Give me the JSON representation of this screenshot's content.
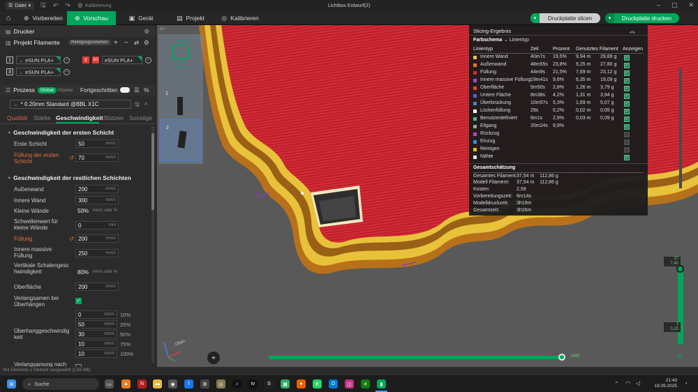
{
  "titlebar": {
    "menu_label": "Datei",
    "calibration_label": "Kalibrierung",
    "window_title": "Lichtbox Entwurf(2)"
  },
  "tabs": {
    "prepare": "Vorbereiten",
    "preview": "Vorschau",
    "device": "Gerät",
    "project": "Projekt",
    "calibrate": "Kalibrieren"
  },
  "actions": {
    "slice": "Druckplatte slicen",
    "print": "Druckplatte drucken"
  },
  "printer": {
    "header": "Drucker"
  },
  "filaments": {
    "header": "Projekt Filamente",
    "cleanup_button": "Reinigungsvolumen",
    "items": [
      {
        "num": "1",
        "name": "eSUN PLA+",
        "color": "#232323"
      },
      {
        "num": "2",
        "badge": "A1",
        "name": "eSUN PLA+",
        "color": "#e53935"
      },
      {
        "num": "3",
        "name": "eSUN PLA+",
        "color": "#232323"
      }
    ]
  },
  "process": {
    "header": "Prozess",
    "global": "Global",
    "objects": "Objekte",
    "advanced": "Fortgeschritten",
    "profile": "* 0.20mm Standard @BBL X1C",
    "subtabs": [
      "Qualität",
      "Stärke",
      "Geschwindigkeit",
      "Stützen",
      "Sonstige"
    ]
  },
  "first_layer": {
    "title": "Geschwindigkeit der ersten Schicht",
    "rows": [
      {
        "label": "Erste Schicht",
        "value": "50",
        "unit": "mm/s"
      },
      {
        "label": "Füllung der ersten Schicht",
        "value": "70",
        "unit": "mm/s"
      }
    ]
  },
  "other_layers": {
    "title": "Geschwindigkeit der restlichen Schichten",
    "rows": [
      {
        "label": "Außenwand",
        "value": "200",
        "unit": "mm/s"
      },
      {
        "label": "Innere Wand",
        "value": "300",
        "unit": "mm/s"
      },
      {
        "label": "Kleine Wände",
        "value": "50%",
        "unit": "mm/s oder %"
      },
      {
        "label": "Schwellenwert für kleine Wände",
        "value": "0",
        "unit": "mm"
      },
      {
        "label": "Füllung",
        "value": "200",
        "unit": "mm/s"
      },
      {
        "label": "Innere massive Füllung",
        "value": "250",
        "unit": "mm/s"
      },
      {
        "label": "Vertikale Schalengeschwindigkeit",
        "value": "80%",
        "unit": "mm/s oder %"
      },
      {
        "label": "Oberfläche",
        "value": "200",
        "unit": "mm/s"
      }
    ],
    "slowdown_label": "Verlangsamen bei Überhängen",
    "overhang_label": "Überhanggeschwindigkeit",
    "overhang_rows": [
      {
        "value": "0",
        "unit": "mm/s",
        "pct": "10%"
      },
      {
        "value": "50",
        "unit": "mm/s",
        "pct": "25%"
      },
      {
        "value": "30",
        "unit": "mm/s",
        "pct": "50%"
      },
      {
        "value": "10",
        "unit": "mm/s",
        "pct": "75%"
      },
      {
        "value": "10",
        "unit": "mm/s",
        "pct": "100%"
      }
    ],
    "slowdown_after_label": "Verlangsamung nach"
  },
  "slicing_result": {
    "title": "Slicing-Ergebnis",
    "color_scheme_label": "Farbschema",
    "color_scheme_value": "Linientyp",
    "columns": [
      "Linientyp",
      "Zeit",
      "Prozent",
      "Genutztes Filament",
      "Anzeigen"
    ],
    "rows": [
      {
        "name": "Innere Wand",
        "time": "40m7s",
        "pct": "19,5%",
        "len": "9,94 m",
        "weight": "29,89 g",
        "color": "#f0c040",
        "shown": true
      },
      {
        "name": "Außenwand",
        "time": "48m55s",
        "pct": "23,8%",
        "len": "9,25 m",
        "weight": "27,80 g",
        "color": "#f07820",
        "shown": true
      },
      {
        "name": "Füllung",
        "time": "44m9s",
        "pct": "21,5%",
        "len": "7,69 m",
        "weight": "23,12 g",
        "color": "#c83232",
        "shown": true
      },
      {
        "name": "Innere massive Füllung",
        "time": "19m41s",
        "pct": "9,6%",
        "len": "6,35 m",
        "weight": "19,09 g",
        "color": "#a050c8",
        "shown": true
      },
      {
        "name": "Oberfläche",
        "time": "5m50s",
        "pct": "2,8%",
        "len": "1,26 m",
        "weight": "3,79 g",
        "color": "#e84040",
        "shown": true
      },
      {
        "name": "Untere Fläche",
        "time": "8m38s",
        "pct": "4,2%",
        "len": "1,31 m",
        "weight": "3,94 g",
        "color": "#6060c8",
        "shown": true
      },
      {
        "name": "Überbrückung",
        "time": "10m57s",
        "pct": "5,3%",
        "len": "1,69 m",
        "weight": "5,07 g",
        "color": "#5080d0",
        "shown": true
      },
      {
        "name": "Lückenfüllung",
        "time": "29s",
        "pct": "0,2%",
        "len": "0,02 m",
        "weight": "0,05 g",
        "color": "#ffffff",
        "shown": true
      },
      {
        "name": "Benutzerdefiniert",
        "time": "6m1s",
        "pct": "2,9%",
        "len": "0,03 m",
        "weight": "0,09 g",
        "color": "#50b890",
        "shown": true
      },
      {
        "name": "Eilgang",
        "time": "20m24s",
        "pct": "9,9%",
        "len": "",
        "weight": "",
        "color": "#a0a0a0",
        "shown": true
      },
      {
        "name": "Rückzug",
        "time": "",
        "pct": "",
        "len": "",
        "weight": "",
        "color": "#c040c0",
        "shown": false
      },
      {
        "name": "Einzug",
        "time": "",
        "pct": "",
        "len": "",
        "weight": "",
        "color": "#4090e0",
        "shown": false
      },
      {
        "name": "Reinigen",
        "time": "",
        "pct": "",
        "len": "",
        "weight": "",
        "color": "#e0c020",
        "shown": false
      },
      {
        "name": "Nähte",
        "time": "",
        "pct": "",
        "len": "",
        "weight": "",
        "color": "#e8e8e8",
        "shown": true
      }
    ],
    "estimate_title": "Gesamtschätzung",
    "estimates": [
      {
        "label": "Gesamtes Filament:",
        "value": "37,54 m    112,86 g"
      },
      {
        "label": "Modell Filament:",
        "value": "37,54 m    112,86 g"
      },
      {
        "label": "Kosten:",
        "value": "2,59"
      },
      {
        "label": "Vorbereitungszeit:",
        "value": "6m14s"
      },
      {
        "label": "Modelldruckzeit:",
        "value": "3h19m"
      },
      {
        "label": "Gesamtzeit:",
        "value": "3h26m"
      }
    ]
  },
  "viewport": {
    "plate_numbers": [
      "1",
      "2"
    ],
    "layer_top": "37",
    "layer_top_height": "7,40",
    "layer_bottom": "1",
    "layer_bottom_height": "0,20",
    "move_value": "2685",
    "axis_label": "Oben"
  },
  "statusbar": {
    "text": "441 Elemente    1 Element ausgewählt (1,63 MB)"
  },
  "taskbar": {
    "search": "Suche",
    "time": "21:43",
    "date": "19.09.2025"
  }
}
